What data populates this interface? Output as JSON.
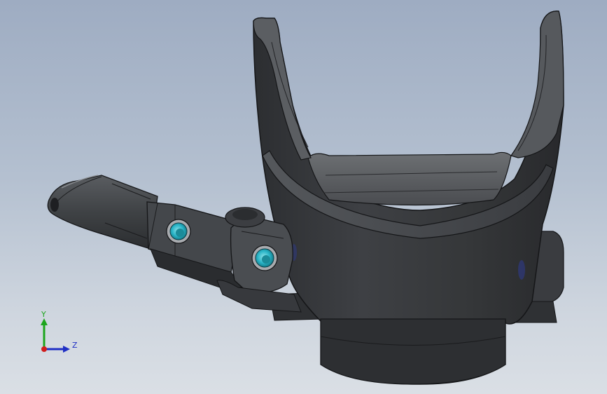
{
  "viewport": {
    "background_top": "#9eacc2",
    "background_bottom": "#dadfe5"
  },
  "model": {
    "part_color": "#3b3d40",
    "edge_color": "#151618",
    "accent_color": "#29b4c7"
  },
  "triad": {
    "y_label": "Y",
    "z_label": "Z",
    "y_color": "#1da51d",
    "z_color": "#1f2fc4",
    "x_color": "#d01d1d"
  }
}
